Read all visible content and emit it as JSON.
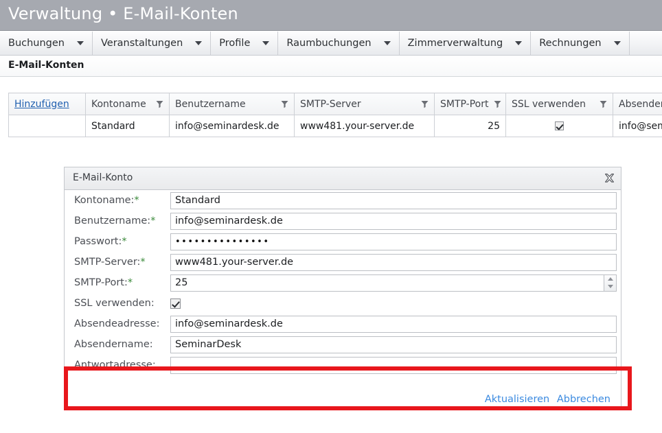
{
  "header": {
    "title": "Verwaltung • E-Mail-Konten"
  },
  "menu": {
    "items": [
      {
        "label": "Buchungen",
        "caret": "chevron-down-icon"
      },
      {
        "label": "Veranstaltungen",
        "caret": "chevron-down-icon"
      },
      {
        "label": "Profile",
        "caret": "chevron-down-icon"
      },
      {
        "label": "Raumbuchungen",
        "caret": "chevron-down-icon"
      },
      {
        "label": "Zimmerverwaltung",
        "caret": "chevron-down-icon"
      },
      {
        "label": "Rechnungen",
        "caret": "chevron-down-icon"
      }
    ]
  },
  "breadcrumb": {
    "label": "E-Mail-Konten"
  },
  "grid": {
    "add_label": "Hinzufügen",
    "filter_icon": "filter-funnel-icon",
    "columns": [
      "Kontoname",
      "Benutzername",
      "SMTP-Server",
      "SMTP-Port",
      "SSL verwenden",
      "Absenderadresse"
    ],
    "rows": [
      {
        "kontoname": "Standard",
        "benutzername": "info@seminardesk.de",
        "smtp_server": "www481.your-server.de",
        "smtp_port": "25",
        "ssl": true,
        "absenderadresse": "info@seminardesk.de"
      }
    ]
  },
  "dialog": {
    "title": "E-Mail-Konto",
    "close_icon": "close-x-icon",
    "required_marker": "*",
    "fields": [
      {
        "label": "Kontoname:",
        "required": true,
        "value": "Standard",
        "type": "text"
      },
      {
        "label": "Benutzername:",
        "required": true,
        "value": "info@seminardesk.de",
        "type": "text"
      },
      {
        "label": "Passwort:",
        "required": true,
        "value": "•••••••••••••••",
        "type": "password"
      },
      {
        "label": "SMTP-Server:",
        "required": true,
        "value": "www481.your-server.de",
        "type": "text"
      },
      {
        "label": "SMTP-Port:",
        "required": true,
        "value": "25",
        "type": "spinner"
      },
      {
        "label": "SSL verwenden:",
        "required": false,
        "value": "",
        "type": "checkbox",
        "checked": true
      },
      {
        "label": "Absendeadresse:",
        "required": false,
        "value": "info@seminardesk.de",
        "type": "text"
      },
      {
        "label": "Absendername:",
        "required": false,
        "value": "SeminarDesk",
        "type": "text"
      },
      {
        "label": "Antwortadresse:",
        "required": false,
        "value": "",
        "type": "text"
      }
    ],
    "actions": {
      "update_label": "Aktualisieren",
      "cancel_label": "Abbrechen"
    }
  },
  "annotation": {
    "highlight_color": "#e8171c"
  }
}
